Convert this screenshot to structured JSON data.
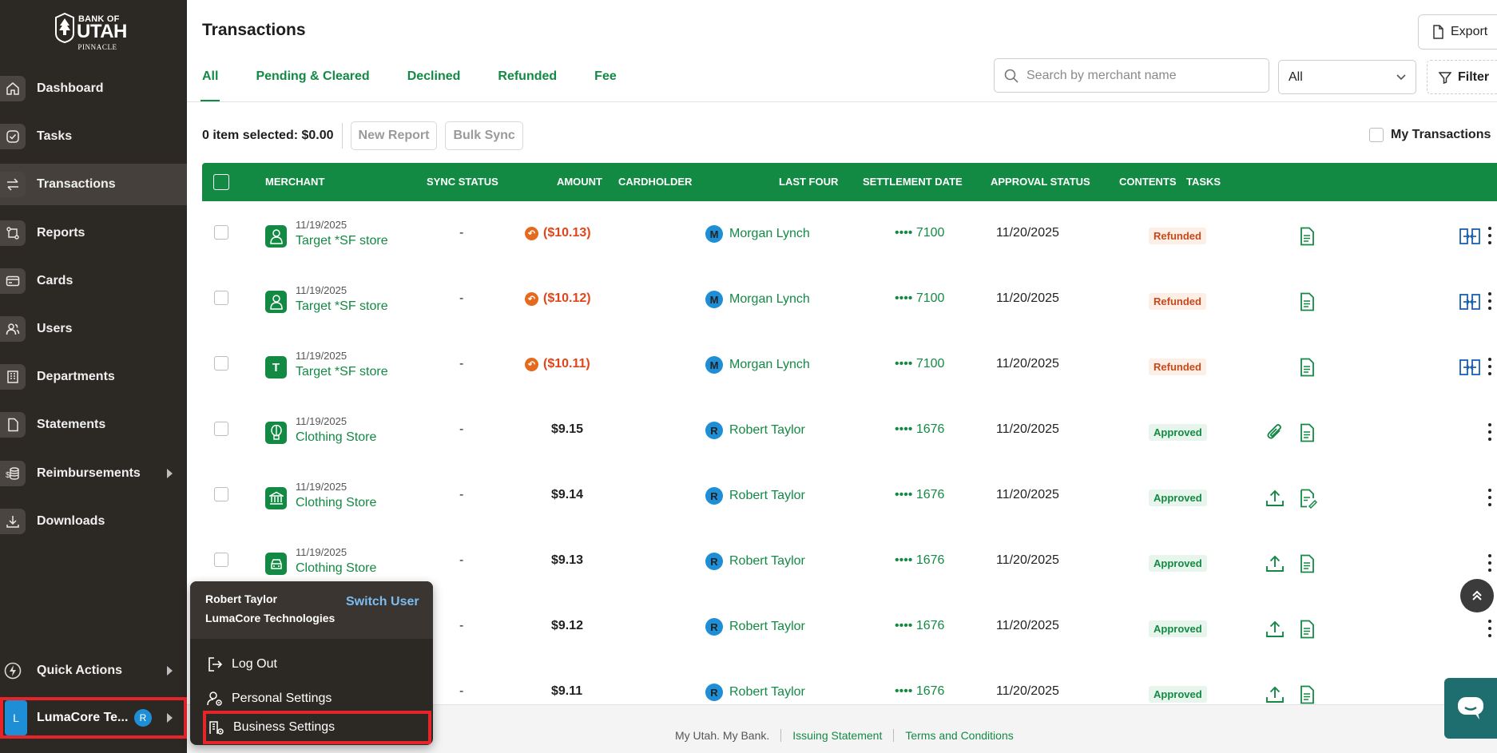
{
  "brand": {
    "bank_of": "BANK OF",
    "utah": "UTAH",
    "pinnacle": "PINNACLE"
  },
  "sidebar": {
    "items": [
      {
        "label": "Dashboard",
        "icon": "home-icon"
      },
      {
        "label": "Tasks",
        "icon": "check-circle-icon"
      },
      {
        "label": "Transactions",
        "icon": "arrows-swap-icon",
        "active": true
      },
      {
        "label": "Reports",
        "icon": "report-flow-icon"
      },
      {
        "label": "Cards",
        "icon": "card-icon"
      },
      {
        "label": "Users",
        "icon": "users-icon"
      },
      {
        "label": "Departments",
        "icon": "building-icon"
      },
      {
        "label": "Statements",
        "icon": "document-icon"
      },
      {
        "label": "Reimbursements",
        "icon": "coins-icon",
        "has_submenu": true
      },
      {
        "label": "Downloads",
        "icon": "download-icon"
      }
    ],
    "quick_actions": "Quick Actions",
    "company": {
      "avatar_letter": "L",
      "name": "LumaCore Te...",
      "user_initial": "R"
    }
  },
  "header": {
    "title": "Transactions",
    "export_label": "Export"
  },
  "tabs": [
    "All",
    "Pending & Cleared",
    "Declined",
    "Refunded",
    "Fee"
  ],
  "search": {
    "placeholder": "Search by merchant name",
    "value": ""
  },
  "status_filter": {
    "selected": "All"
  },
  "filter_label": "Filter",
  "selection": {
    "text": "0 item selected: $0.00",
    "new_report": "New Report",
    "bulk_sync": "Bulk Sync",
    "my_transactions": "My Transactions"
  },
  "table": {
    "columns": [
      "MERCHANT",
      "SYNC STATUS",
      "AMOUNT",
      "CARDHOLDER",
      "LAST FOUR",
      "SETTLEMENT DATE",
      "APPROVAL STATUS",
      "CONTENTS",
      "TASKS"
    ],
    "rows": [
      {
        "date": "11/19/2025",
        "merchant": "Target *SF store",
        "merchant_icon": "person-icon",
        "sync": "-",
        "amount": "($10.13)",
        "refund": true,
        "cardholder_initial": "M",
        "cardholder": "Morgan Lynch",
        "last_four": "•••• 7100",
        "settlement": "11/20/2025",
        "status": "Refunded",
        "contents": [
          "receipt-icon"
        ],
        "split": true
      },
      {
        "date": "11/19/2025",
        "merchant": "Target *SF store",
        "merchant_icon": "person-icon",
        "sync": "-",
        "amount": "($10.12)",
        "refund": true,
        "cardholder_initial": "M",
        "cardholder": "Morgan Lynch",
        "last_four": "•••• 7100",
        "settlement": "11/20/2025",
        "status": "Refunded",
        "contents": [
          "receipt-icon"
        ],
        "split": true
      },
      {
        "date": "11/19/2025",
        "merchant": "Target *SF store",
        "merchant_icon": "letter-t",
        "merchant_letter": "T",
        "sync": "-",
        "amount": "($10.11)",
        "refund": true,
        "cardholder_initial": "M",
        "cardholder": "Morgan Lynch",
        "last_four": "•••• 7100",
        "settlement": "11/20/2025",
        "status": "Refunded",
        "contents": [
          "receipt-icon"
        ],
        "split": true
      },
      {
        "date": "11/19/2025",
        "merchant": "Clothing Store",
        "merchant_icon": "balloon-icon",
        "sync": "-",
        "amount": "$9.15",
        "refund": false,
        "cardholder_initial": "R",
        "cardholder": "Robert Taylor",
        "last_four": "•••• 1676",
        "settlement": "11/20/2025",
        "status": "Approved",
        "contents": [
          "paperclip-icon",
          "receipt-icon"
        ],
        "split": false
      },
      {
        "date": "11/19/2025",
        "merchant": "Clothing Store",
        "merchant_icon": "bank-icon",
        "sync": "-",
        "amount": "$9.14",
        "refund": false,
        "cardholder_initial": "R",
        "cardholder": "Robert Taylor",
        "last_four": "•••• 1676",
        "settlement": "11/20/2025",
        "status": "Approved",
        "contents": [
          "upload-icon",
          "receipt-edit-icon"
        ],
        "split": false
      },
      {
        "date": "11/19/2025",
        "merchant": "Clothing Store",
        "merchant_icon": "car-icon",
        "sync": "-",
        "amount": "$9.13",
        "refund": false,
        "cardholder_initial": "R",
        "cardholder": "Robert Taylor",
        "last_four": "•••• 1676",
        "settlement": "11/20/2025",
        "status": "Approved",
        "contents": [
          "upload-icon",
          "receipt-icon"
        ],
        "split": false
      },
      {
        "date": "",
        "merchant": "",
        "merchant_icon": "",
        "sync": "-",
        "amount": "$9.12",
        "refund": false,
        "cardholder_initial": "R",
        "cardholder": "Robert Taylor",
        "last_four": "•••• 1676",
        "settlement": "11/20/2025",
        "status": "Approved",
        "contents": [
          "upload-icon",
          "receipt-icon"
        ],
        "split": false
      },
      {
        "date": "",
        "merchant": "",
        "merchant_icon": "",
        "sync": "-",
        "amount": "$9.11",
        "refund": false,
        "cardholder_initial": "R",
        "cardholder": "Robert Taylor",
        "last_four": "•••• 1676",
        "settlement": "11/20/2025",
        "status": "Approved",
        "contents": [
          "upload-icon",
          "receipt-icon"
        ],
        "split": false
      }
    ]
  },
  "footer": {
    "tagline": "My Utah. My Bank.",
    "issuing_statement": "Issuing Statement",
    "terms": "Terms and Conditions"
  },
  "account_menu": {
    "user_name": "Robert Taylor",
    "company": "LumaCore Technologies",
    "switch_user": "Switch User",
    "items": [
      {
        "label": "Log Out",
        "icon": "logout-icon"
      },
      {
        "label": "Personal Settings",
        "icon": "user-gear-icon"
      },
      {
        "label": "Business Settings",
        "icon": "building-gear-icon",
        "highlighted": true
      }
    ]
  },
  "colors": {
    "brand_green": "#138a44",
    "sidebar_bg": "#2c2824",
    "refund_orange": "#e1451a",
    "highlight_red": "#e8242b",
    "avatar_blue": "#1e8fd6"
  }
}
